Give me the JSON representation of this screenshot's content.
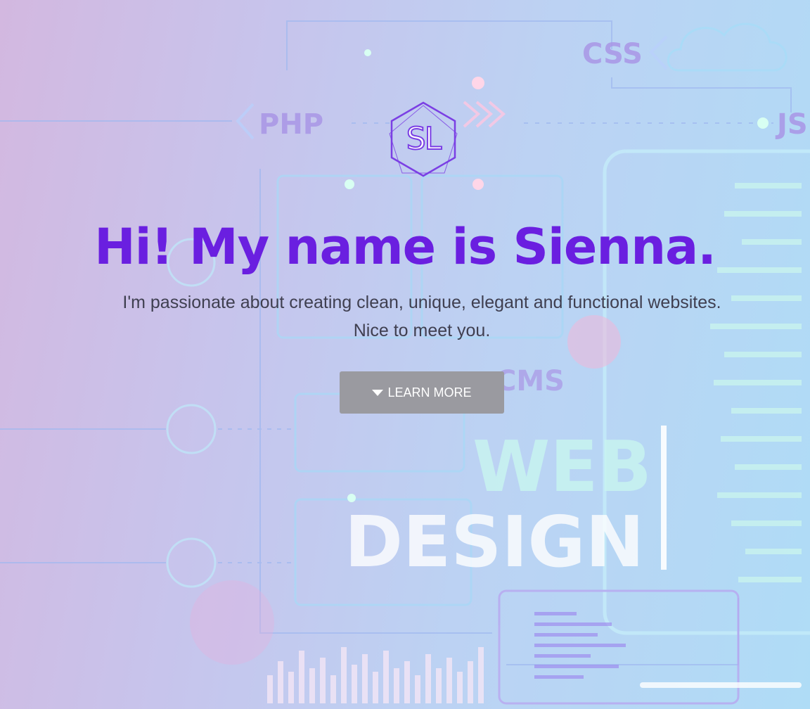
{
  "background": {
    "labels": [
      "CSS",
      "PHP",
      "JS",
      "CMS",
      "WEB",
      "DESIGN"
    ]
  },
  "logo": {
    "text": "SL",
    "icon": "hexagon-logo-icon"
  },
  "hero": {
    "title": "Hi! My name is Sienna.",
    "subtitle_line1": "I'm passionate about creating clean, unique, elegant and functional websites.",
    "subtitle_line2": "Nice to meet you.",
    "button_label": "LEARN MORE",
    "button_icon": "caret-down-icon"
  },
  "colors": {
    "title": "#6a1fe0",
    "button": "#9a9aa0",
    "logo": "#7b3fe4"
  }
}
